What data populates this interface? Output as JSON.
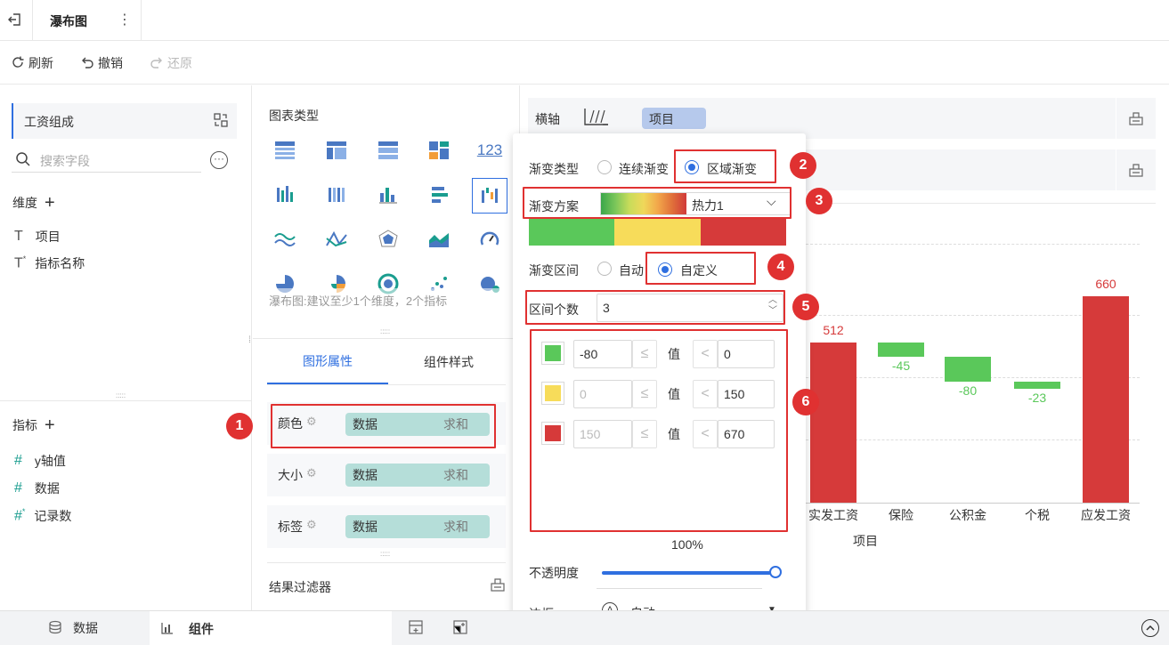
{
  "topbar": {
    "title": "瀑布图"
  },
  "toolbar": {
    "refresh": "刷新",
    "undo": "撤销",
    "redo": "还原"
  },
  "left": {
    "dataset": "工资组成",
    "search_placeholder": "搜索字段",
    "dimension_header": "维度",
    "dimensions": [
      "项目",
      "指标名称"
    ],
    "metric_header": "指标",
    "metrics": [
      "y轴值",
      "数据",
      "记录数"
    ]
  },
  "mid": {
    "chart_type_label": "图表类型",
    "chart_hint": "瀑布图:建议至少1个维度，2个指标",
    "tabs": [
      "图形属性",
      "组件样式"
    ],
    "rows": [
      {
        "label": "颜色",
        "field": "数据",
        "agg": "求和"
      },
      {
        "label": "大小",
        "field": "数据",
        "agg": "求和"
      },
      {
        "label": "标签",
        "field": "数据",
        "agg": "求和"
      }
    ],
    "filter_label": "结果过滤器"
  },
  "axis": {
    "x_label": "横轴",
    "x_field": "项目"
  },
  "popover": {
    "gradient_type_label": "渐变类型",
    "gradient_continuous": "连续渐变",
    "gradient_region": "区域渐变",
    "scheme_label": "渐变方案",
    "scheme_value": "热力1",
    "interval_label": "渐变区间",
    "interval_auto": "自动",
    "interval_custom": "自定义",
    "count_label": "区间个数",
    "count_value": "3",
    "ranges": [
      {
        "color": "#5ac85a",
        "from": "-80",
        "to": "0",
        "disabled": false
      },
      {
        "color": "#f7dc5a",
        "from": "0",
        "to": "150",
        "disabled": true
      },
      {
        "color": "#d63a3a",
        "from": "150",
        "to": "670",
        "disabled": true
      }
    ],
    "value_label": "值",
    "opacity_label": "不透明度",
    "opacity_value": "100%",
    "border_label": "边框",
    "border_value": "自动"
  },
  "chart_data": {
    "type": "bar",
    "categories": [
      "实发工资",
      "保险",
      "公积金",
      "个税",
      "应发工资"
    ],
    "values": [
      512,
      -45,
      -80,
      -23,
      660
    ],
    "xlabel": "项目",
    "colors": [
      "#d63a3a",
      "#5ac85a",
      "#5ac85a",
      "#5ac85a",
      "#d63a3a"
    ]
  },
  "badges": [
    "1",
    "2",
    "3",
    "4",
    "5",
    "6"
  ],
  "bottom": {
    "data_tab": "数据",
    "component_tab": "组件"
  }
}
